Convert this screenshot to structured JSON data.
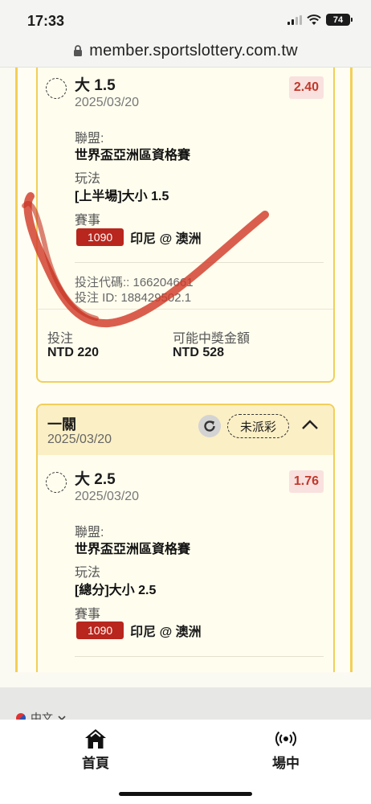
{
  "status_bar": {
    "time": "17:33",
    "battery": "74"
  },
  "browser": {
    "url": "member.sportslottery.com.tw"
  },
  "labels": {
    "league": "聯盟:",
    "market": "玩法",
    "event": "賽事",
    "stake": "投注",
    "potential_win": "可能中獎金額"
  },
  "bet1": {
    "selection": "大 1.5",
    "date": "2025/03/20",
    "odds": "2.40",
    "league": "世界盃亞洲區資格賽",
    "market": "[上半場]大小 1.5",
    "match_id": "1090",
    "match_name": "印尼 @ 澳洲",
    "code": "投注代碼:: 166204661",
    "bet_id": "投注 ID: 188429502.1",
    "stake": "NTD 220",
    "potential_win": "NTD 528"
  },
  "bet2": {
    "title": "一關",
    "date": "2025/03/20",
    "status": "未派彩",
    "selection": "大 2.5",
    "selection_date": "2025/03/20",
    "odds": "1.76",
    "league": "世界盃亞洲區資格賽",
    "market": "[總分]大小 2.5",
    "match_id": "1090",
    "match_name": "印尼 @ 澳洲"
  },
  "footer": {
    "language": "中文"
  },
  "tabs": [
    {
      "label": "首頁",
      "icon": "home-icon"
    },
    {
      "label": "場中",
      "icon": "live-icon"
    }
  ],
  "colors": {
    "accent_border": "#f1cf5a",
    "header_bg": "#fbefc5",
    "odds_text": "#c0392b",
    "odds_bg": "#f9e1df",
    "match_badge": "#b8261d",
    "scribble": "#d23a2a"
  }
}
